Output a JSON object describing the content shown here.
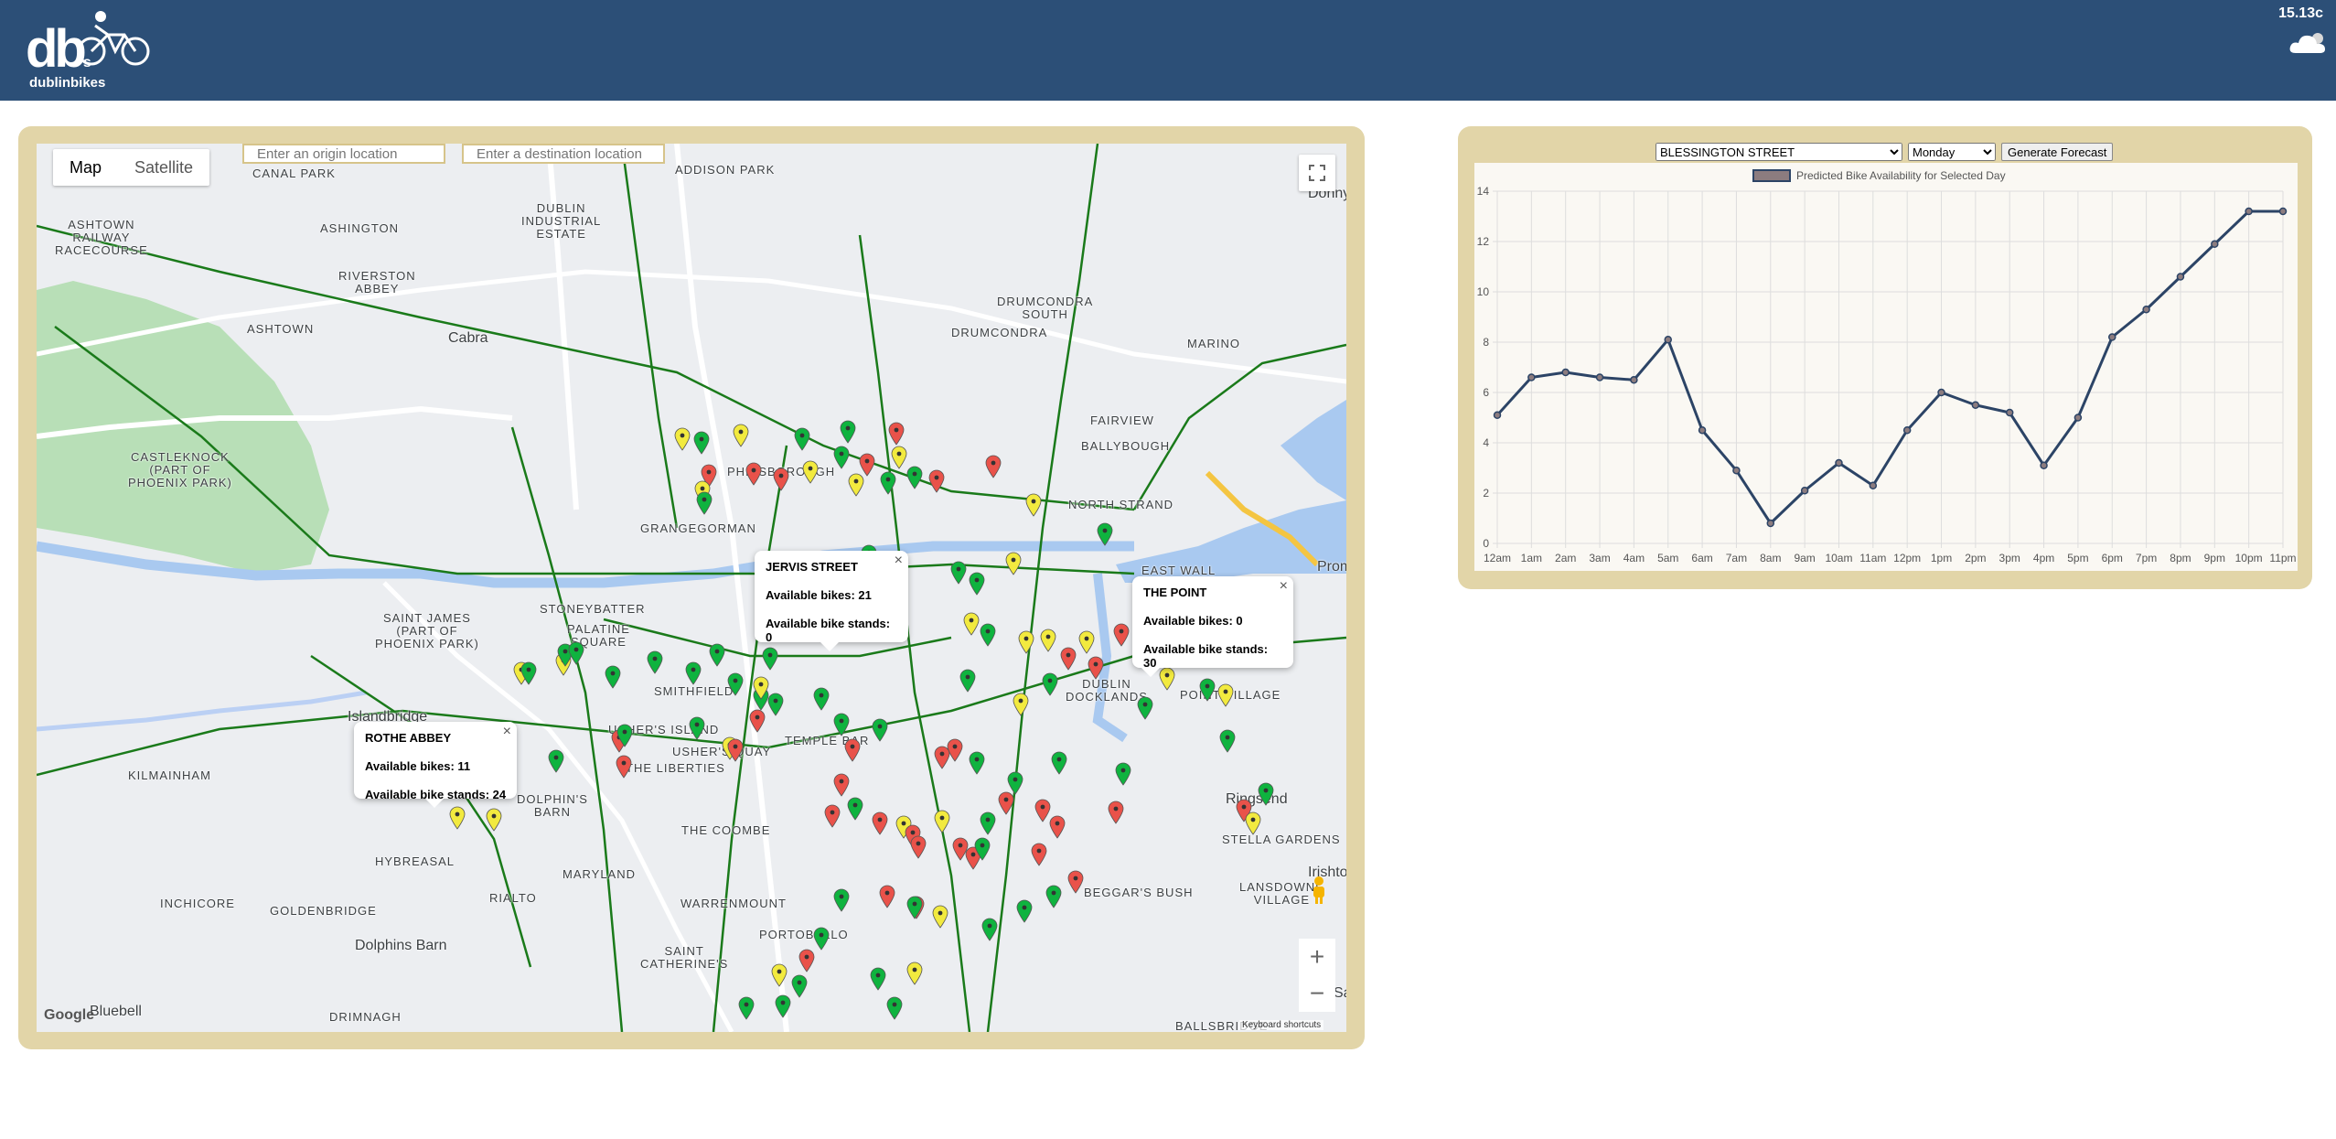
{
  "header": {
    "logo_mark": "db",
    "logo_suffix": "s",
    "logo_text": "dublinbikes",
    "temperature": "15.13c",
    "weather_icon": "cloud-icon"
  },
  "map": {
    "type_buttons": [
      "Map",
      "Satellite"
    ],
    "origin_placeholder": "Enter an origin location",
    "destination_placeholder": "Enter a destination location",
    "google_label": "Google",
    "keyboard_shortcuts": "Keyboard shortcuts",
    "place_labels": [
      "ASHTOWN\nRAILWAY\nRACECOURSE",
      "DUBLIN\nINDUSTRIAL\nESTATE",
      "RIVERSTON\nABBEY",
      "ASHTOWN",
      "Cabra",
      "CANAL PARK",
      "ASHINGTON",
      "DRUMCONDRA\nSOUTH",
      "DRUMCONDRA",
      "MARINO",
      "FAIRVIEW",
      "BALLYBOUGH",
      "NORTH STRAND",
      "EAST WALL",
      "PHIBSBOROUGH",
      "GRANGEGORMAN",
      "CASTLEKNOCK\n(PART OF\nPHOENIX PARK)",
      "SAINT JAMES\n(PART OF\nPHOENIX PARK)",
      "STONEYBATTER",
      "PALATINE\nSQUARE",
      "SMITHFIELD",
      "USHER'S ISLAND",
      "USHER'S QUAY",
      "TEMPLE BAR",
      "THE LIBERTIES",
      "THE COOMBE",
      "Islandbridge",
      "KILMAINHAM",
      "DOLPHIN'S\nBARN",
      "HYBREASAL",
      "MARYLAND",
      "RIALTO",
      "INCHICORE",
      "GOLDENBRIDGE",
      "WARRENMOUNT",
      "PORTOBELLO",
      "SAINT\nCATHERINE'S",
      "Dolphins Barn",
      "DRIMNAGH",
      "Bluebell",
      "DUBLIN\nDOCKLANDS",
      "POINT VILLAGE",
      "Ringsend",
      "STELLA GARDENS",
      "LANSDOWNE\nVILLAGE",
      "BEGGAR'S BUSH",
      "BALLSBRIDGE",
      "Irishtown",
      "ADDISON PARK",
      "Donnyc",
      "Promen",
      "Sa"
    ],
    "info_windows": [
      {
        "title": "ROTHE ABBEY",
        "bikes": "Available bikes: 11",
        "stands": "Available bike stands: 24"
      },
      {
        "title": "JERVIS STREET",
        "bikes": "Available bikes: 21",
        "stands": "Available bike stands: 0"
      },
      {
        "title": "THE POINT",
        "bikes": "Available bikes: 0",
        "stands": "Available bike stands: 30"
      }
    ],
    "marker_colors": {
      "green": "#0fb33f",
      "yellow": "#f2ea3f",
      "red": "#e9524a"
    }
  },
  "forecast": {
    "station_selected": "BLESSINGTON STREET",
    "day_selected": "Monday",
    "button_label": "Generate Forecast"
  },
  "chart_data": {
    "type": "line",
    "legend": "Predicted Bike Availability for Selected Day",
    "categories": [
      "12am",
      "1am",
      "2am",
      "3am",
      "4am",
      "5am",
      "6am",
      "7am",
      "8am",
      "9am",
      "10am",
      "11am",
      "12pm",
      "1pm",
      "2pm",
      "3pm",
      "4pm",
      "5pm",
      "6pm",
      "7pm",
      "8pm",
      "9pm",
      "10pm",
      "11pm"
    ],
    "values": [
      5.1,
      6.6,
      6.8,
      6.6,
      6.5,
      8.1,
      4.5,
      2.9,
      0.8,
      2.1,
      3.2,
      2.3,
      4.5,
      6.0,
      5.5,
      5.2,
      3.1,
      5.0,
      8.2,
      9.3,
      10.6,
      11.9,
      13.2,
      13.2
    ],
    "ylim": [
      0,
      14
    ],
    "yticks": [
      "0",
      "2",
      "4",
      "6",
      "8",
      "10",
      "12",
      "14"
    ],
    "line_color": "#2c4466",
    "grid": true
  }
}
